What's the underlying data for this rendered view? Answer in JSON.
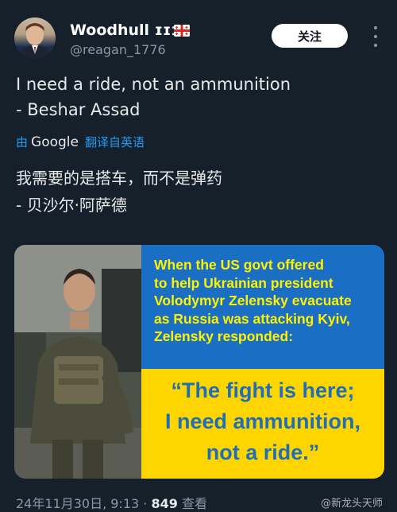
{
  "author": {
    "name": "Woodhull ɪɪɪ",
    "handle": "@reagan_1776"
  },
  "follow_label": "关注",
  "tweet": {
    "line1": "I need a ride, not an ammunition",
    "line2": "- Beshar Assad"
  },
  "translation": {
    "by": "由",
    "provider": "Google",
    "action": "翻译自英语",
    "line1": "我需要的是搭车，而不是弹药",
    "line2": "- 贝沙尔·阿萨德"
  },
  "media": {
    "caption_lines": [
      "When the US govt offered",
      "to help Ukrainian president",
      "Volodymyr Zelensky evacuate",
      "as Russia was attacking Kyiv,",
      "Zelensky responded:"
    ],
    "quote_lines": [
      "“The fight is here;",
      "I need ammunition,",
      "not a ride.”"
    ]
  },
  "footer": {
    "timestamp": "24年11月30日, 9:13 ·",
    "views": "849",
    "views_label": "查看"
  },
  "watermark": "@新龙头天师",
  "colors": {
    "background": "#15202b",
    "link": "#1d9bf0",
    "caption_blue": "#1a6fc4",
    "caption_yellow": "#fff200",
    "quote_yellow": "#ffd500",
    "quote_blue": "#1f6fb8"
  },
  "icons": {
    "more": "more-vertical-icon",
    "flag": "georgia-flag-icon"
  }
}
